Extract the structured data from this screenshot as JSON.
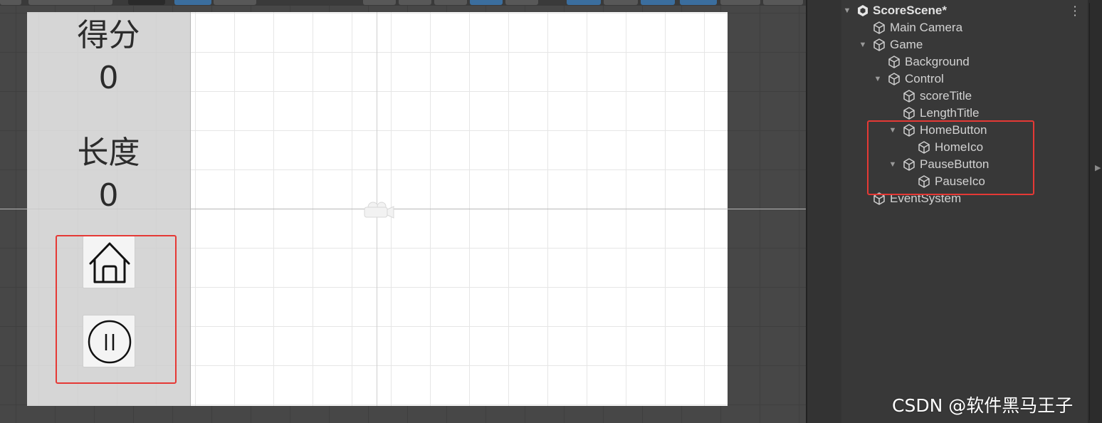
{
  "scene": {
    "panel": {
      "score_label": "得分",
      "score_value": "0",
      "length_label": "长度",
      "length_value": "0"
    },
    "buttons": [
      {
        "icon": "home-icon"
      },
      {
        "icon": "pause-icon"
      }
    ]
  },
  "hierarchy": {
    "scene_name": "ScoreScene*",
    "items": [
      {
        "label": "Main Camera"
      },
      {
        "label": "Game"
      },
      {
        "label": "Background"
      },
      {
        "label": "Control"
      },
      {
        "label": "scoreTitle"
      },
      {
        "label": "LengthTitle"
      },
      {
        "label": "HomeButton"
      },
      {
        "label": "HomeIco"
      },
      {
        "label": "PauseButton"
      },
      {
        "label": "PauseIco"
      },
      {
        "label": "EventSystem"
      }
    ]
  },
  "watermark": "CSDN @软件黑马王子",
  "colors": {
    "highlight": "#e53935",
    "editor_bg": "#474747",
    "hierarchy_bg": "#383838"
  }
}
